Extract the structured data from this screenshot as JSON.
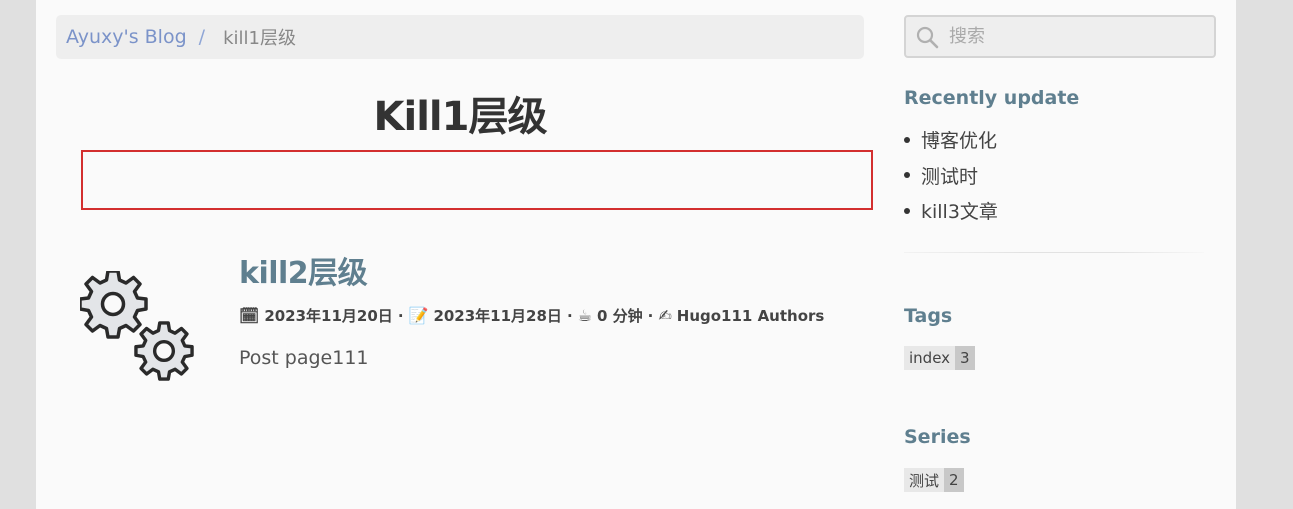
{
  "breadcrumb": {
    "home": "Ayuxy's Blog",
    "separator": "/",
    "current": "kill1层级"
  },
  "search": {
    "placeholder": "搜索",
    "icon": "search-icon"
  },
  "page": {
    "title": "Kill1层级"
  },
  "post": {
    "icon": "gears-icon",
    "title": "kill2层级",
    "meta": {
      "date_icon": "🗓",
      "date": "2023年11月20日",
      "updated_icon": "📝",
      "updated": "2023年11月28日",
      "reading_icon": "☕",
      "reading_time": "0 分钟",
      "author_icon": "✍",
      "author": "Hugo111 Authors",
      "separator": "·"
    },
    "summary": "Post page111"
  },
  "sidebar": {
    "recent": {
      "heading": "Recently update",
      "items": [
        "博客优化",
        "测试时",
        "kill3文章"
      ]
    },
    "tags": {
      "heading": "Tags",
      "items": [
        {
          "name": "index",
          "count": "3"
        }
      ]
    },
    "series": {
      "heading": "Series",
      "items": [
        {
          "name": "测试",
          "count": "2"
        }
      ]
    }
  },
  "colors": {
    "accent": "#5f7f8f",
    "link": "#7b93c9",
    "highlight_border": "#d32f2f"
  }
}
